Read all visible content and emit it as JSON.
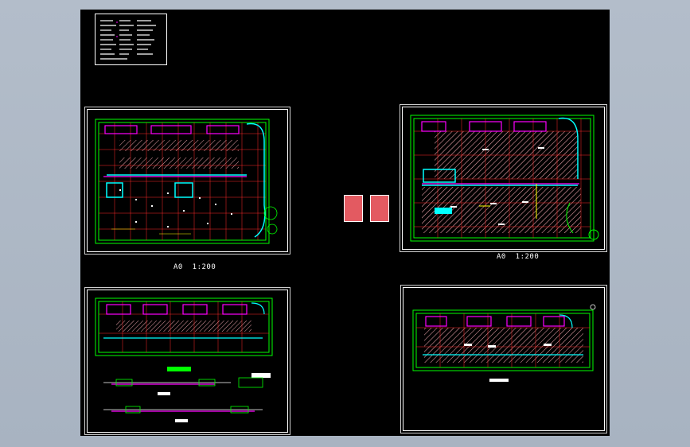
{
  "window": {
    "colors": {
      "background": "#000000",
      "wall_green": "#00ff00",
      "grid_red": "#ff2a2a",
      "accent_magenta": "#ff00ff",
      "accent_cyan": "#00ffff",
      "white": "#ffffff",
      "yellow": "#ffff00",
      "hatch_pink": "#e7a0a8"
    }
  },
  "drawings": {
    "top_left_scale": "A0  1:200",
    "top_right_scale": "A0  1:200"
  }
}
